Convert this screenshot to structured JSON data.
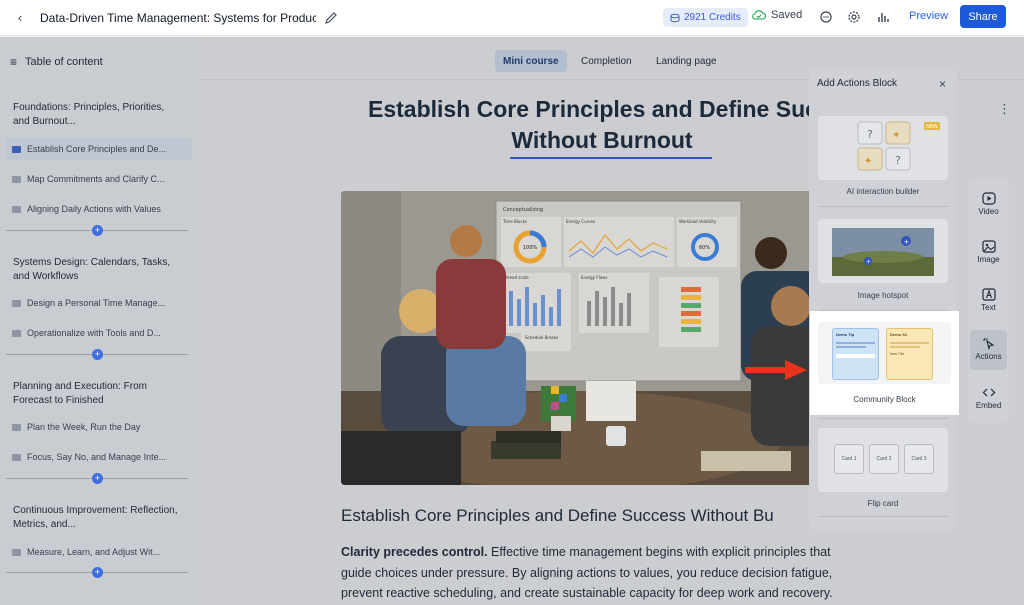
{
  "topbar": {
    "title": "Data-Driven Time Management: Systems for Productivity a",
    "credits": "2921 Credits",
    "saved": "Saved",
    "preview": "Preview",
    "share": "Share"
  },
  "sidebar": {
    "header": "Table of content",
    "sections": [
      {
        "title": "Foundations: Principles, Priorities, and Burnout...",
        "items": [
          "Establish Core Principles and De...",
          "Map Commitments and Clarify C...",
          "Aligning Daily Actions with Values"
        ]
      },
      {
        "title": "Systems Design: Calendars, Tasks, and Workflows",
        "items": [
          "Design a Personal Time Manage...",
          "Operationalize with Tools and D..."
        ]
      },
      {
        "title": "Planning and Execution: From Forecast to Finished",
        "items": [
          "Plan the Week, Run the Day",
          "Focus, Say No, and Manage Inte..."
        ]
      },
      {
        "title": "Continuous Improvement: Reflection, Metrics, and...",
        "items": [
          "Measure, Learn, and Adjust Wit..."
        ]
      }
    ]
  },
  "tabs": [
    "Mini course",
    "Completion",
    "Landing page"
  ],
  "main": {
    "heading": "Establish Core Principles and Define Succ",
    "heading_line2": "Without Burnout",
    "subheading": "Establish Core Principles and Define Success Without Bu",
    "para_bold": "Clarity precedes control.",
    "para_rest": " Effective time management begins with explicit principles that guide choices under pressure. By aligning actions to values, you reduce decision fatigue, prevent reactive scheduling, and create sustainable capacity for deep work and recovery."
  },
  "hero": {
    "board_title": "Conceptualizing",
    "board_labels": [
      "Time Blocks",
      "Energy Curves",
      "Workload Volatility",
      "Thread scale",
      "Energy Flows",
      "Schedule Breaks"
    ],
    "donut_value": "100%",
    "donut_value2": "60%"
  },
  "panel": {
    "title": "Add Actions Block",
    "cards": [
      {
        "label": "AI interaction builder",
        "badge": "NEW"
      },
      {
        "label": "Image hotspot"
      },
      {
        "label": "Community Block",
        "mini1_title": "Demo Tip",
        "mini2_title": "Demo S2",
        "mini2_label": "New Title"
      },
      {
        "label": "Flip card",
        "flips": [
          "Card 1",
          "Card 2",
          "Card 3"
        ]
      }
    ]
  },
  "tools": [
    "Video",
    "Image",
    "Text",
    "Actions",
    "Embed"
  ],
  "colors": {
    "accent": "#1d5ad8",
    "arrow": "#e8341c",
    "overlay": "#cbcdd1"
  }
}
